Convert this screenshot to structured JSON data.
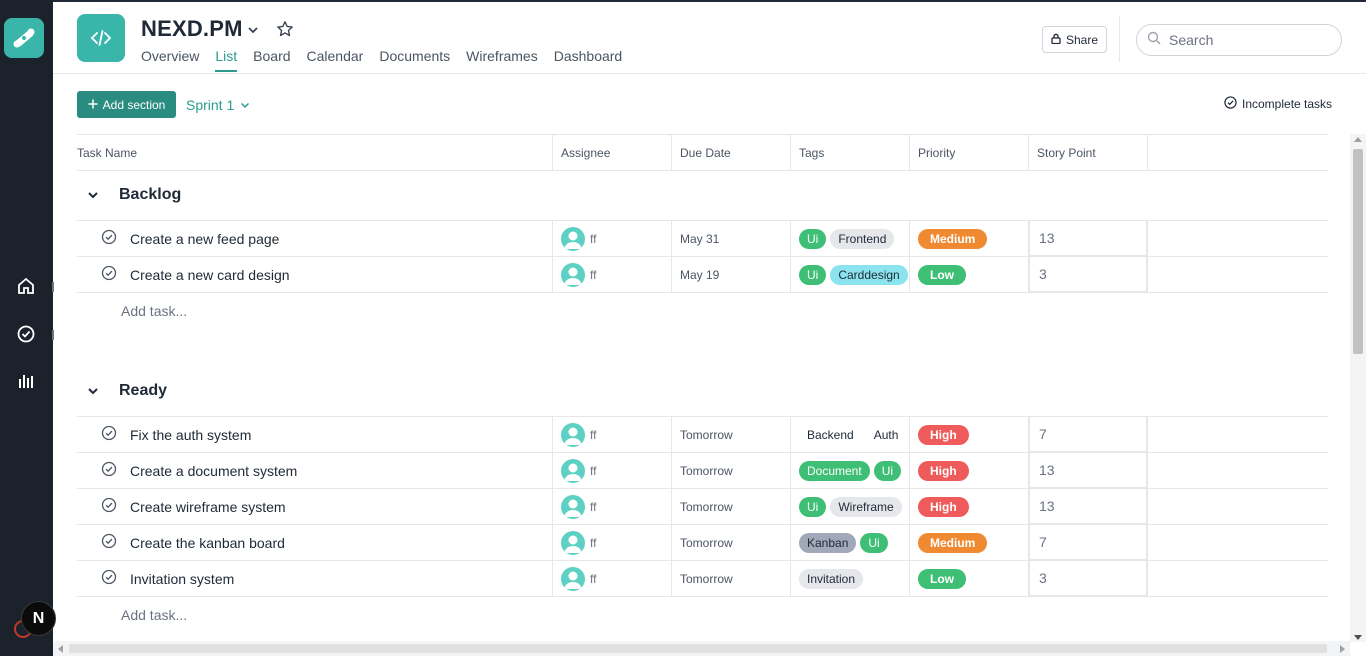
{
  "colors": {
    "accent": "#2a9d8f",
    "rail": "#1c222b",
    "brand_tile": "#3ab5a9",
    "priority_medium": "#ef8a33",
    "priority_low": "#3fbf75",
    "priority_high": "#ef5b5b"
  },
  "rail": {
    "logo_icon": "logo-icon",
    "items": [
      {
        "name": "home-icon"
      },
      {
        "name": "tasks-icon"
      },
      {
        "name": "analytics-icon"
      }
    ],
    "avatar_letter": "N"
  },
  "header": {
    "title": "NEXD.PM",
    "tabs": [
      {
        "label": "Overview",
        "active": false
      },
      {
        "label": "List",
        "active": true
      },
      {
        "label": "Board",
        "active": false
      },
      {
        "label": "Calendar",
        "active": false
      },
      {
        "label": "Documents",
        "active": false
      },
      {
        "label": "Wireframes",
        "active": false
      },
      {
        "label": "Dashboard",
        "active": false
      }
    ],
    "share_label": "Share",
    "search_placeholder": "Search"
  },
  "toolbar": {
    "add_section_label": "Add section",
    "sprint_label": "Sprint 1",
    "incomplete_label": "Incomplete tasks"
  },
  "table": {
    "columns": [
      "Task Name",
      "Assignee",
      "Due Date",
      "Tags",
      "Priority",
      "Story Point"
    ],
    "add_task_label": "Add task...",
    "sections": [
      {
        "name": "Backlog",
        "tasks": [
          {
            "name": "Create a new feed page",
            "assignee": "ff",
            "due": "May 31",
            "tags": [
              {
                "label": "Ui",
                "style": "green"
              },
              {
                "label": "Frontend",
                "style": "gray"
              }
            ],
            "priority": "Medium",
            "priority_style": "medium",
            "story_point": "13"
          },
          {
            "name": "Create a new card design",
            "assignee": "ff",
            "due": "May 19",
            "tags": [
              {
                "label": "Ui",
                "style": "green"
              },
              {
                "label": "Carddesign",
                "style": "cyan"
              }
            ],
            "priority": "Low",
            "priority_style": "low",
            "story_point": "3"
          }
        ]
      },
      {
        "name": "Ready",
        "tasks": [
          {
            "name": "Fix the auth system",
            "assignee": "ff",
            "due": "Tomorrow",
            "tags": [
              {
                "label": "Backend",
                "style": "white"
              },
              {
                "label": "Auth",
                "style": "white"
              }
            ],
            "priority": "High",
            "priority_style": "high",
            "story_point": "7"
          },
          {
            "name": "Create a document system",
            "assignee": "ff",
            "due": "Tomorrow",
            "tags": [
              {
                "label": "Document",
                "style": "green"
              },
              {
                "label": "Ui",
                "style": "green"
              }
            ],
            "priority": "High",
            "priority_style": "high",
            "story_point": "13"
          },
          {
            "name": "Create wireframe system",
            "assignee": "ff",
            "due": "Tomorrow",
            "tags": [
              {
                "label": "Ui",
                "style": "green"
              },
              {
                "label": "Wireframe",
                "style": "gray"
              }
            ],
            "priority": "High",
            "priority_style": "high",
            "story_point": "13"
          },
          {
            "name": "Create the kanban board",
            "assignee": "ff",
            "due": "Tomorrow",
            "tags": [
              {
                "label": "Kanban",
                "style": "slate"
              },
              {
                "label": "Ui",
                "style": "green"
              }
            ],
            "priority": "Medium",
            "priority_style": "medium",
            "story_point": "7"
          },
          {
            "name": "Invitation system",
            "assignee": "ff",
            "due": "Tomorrow",
            "tags": [
              {
                "label": "Invitation",
                "style": "gray"
              }
            ],
            "priority": "Low",
            "priority_style": "low",
            "story_point": "3"
          }
        ]
      }
    ]
  }
}
